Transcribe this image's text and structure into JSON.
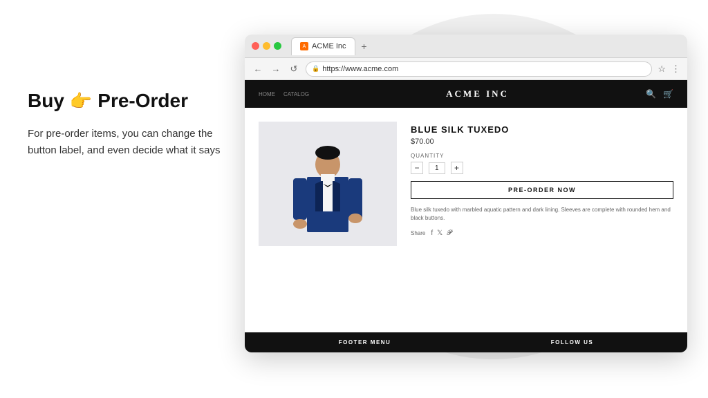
{
  "page": {
    "background": "#ffffff"
  },
  "left": {
    "headline": "Buy",
    "emoji": "👉",
    "headline2": "Pre-Order",
    "description": "For pre-order items, you can change the button label, and even decide what it says"
  },
  "browser": {
    "tab_title": "ACME Inc",
    "tab_favicon": "A",
    "url": "https://www.acme.com",
    "nav": {
      "back": "←",
      "forward": "→",
      "refresh": "↺",
      "bookmark": "☆",
      "more": "⋮"
    }
  },
  "store": {
    "logo": "ACME INC",
    "nav": [
      "HOME",
      "CATALOG"
    ],
    "footer_cols": [
      "FOOTER MENU",
      "FOLLOW US"
    ],
    "product": {
      "title": "BLUE SILK TUXEDO",
      "price": "$70.00",
      "quantity_label": "QUANTITY",
      "quantity": "1",
      "btn_label": "PRE-ORDER NOW",
      "description": "Blue silk tuxedo with marbled aquatic pattern and dark lining. Sleeves are complete with rounded hem and black buttons.",
      "share_label": "Share"
    }
  }
}
